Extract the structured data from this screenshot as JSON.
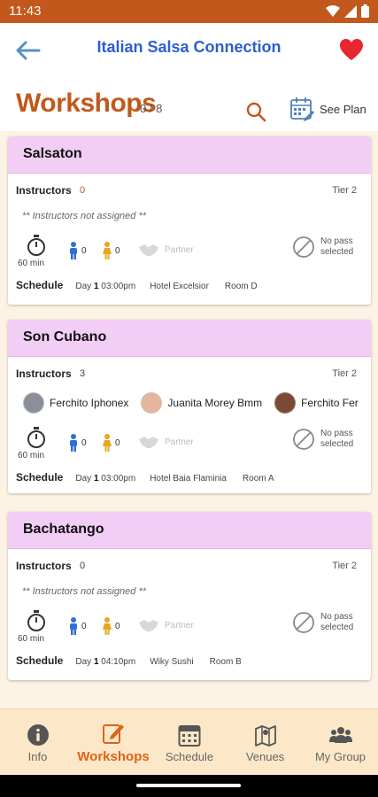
{
  "status_bar": {
    "time": "11:43"
  },
  "header": {
    "title": "Italian Salsa Connection"
  },
  "page": {
    "title": "Workshops",
    "count": "0 / 8",
    "see_plan_label": "See Plan"
  },
  "workshops": [
    {
      "name": "Salsaton",
      "instructors_label": "Instructors",
      "instructors_count": "0",
      "tier": "Tier 2",
      "not_assigned": "** Instructors not assigned **",
      "duration": "60 min",
      "male_count": "0",
      "female_count": "0",
      "partner_label": "Partner",
      "pass_label": "No pass selected",
      "schedule_label": "Schedule",
      "day_label": "Day",
      "day_num": "1",
      "time": "03:00pm",
      "venue": "Hotel Excelsior",
      "room": "Room D"
    },
    {
      "name": "Son Cubano",
      "instructors_label": "Instructors",
      "instructors_count": "3",
      "tier": "Tier 2",
      "instructors": [
        {
          "name": "Ferchito Iphonex",
          "avatar_color": "#8a8f9a"
        },
        {
          "name": "Juanita Morey Bmm",
          "avatar_color": "#e3b6a0"
        },
        {
          "name": "Ferchito Fer",
          "avatar_color": "#7a4a36"
        }
      ],
      "duration": "60 min",
      "male_count": "0",
      "female_count": "0",
      "partner_label": "Partner",
      "pass_label": "No pass selected",
      "schedule_label": "Schedule",
      "day_label": "Day",
      "day_num": "1",
      "time": "03:00pm",
      "venue": "Hotel Baia Flaminia",
      "room": "Room A"
    },
    {
      "name": "Bachatango",
      "instructors_label": "Instructors",
      "instructors_count": "0",
      "tier": "Tier 2",
      "not_assigned": "** Instructors not assigned **",
      "duration": "60 min",
      "male_count": "0",
      "female_count": "0",
      "partner_label": "Partner",
      "pass_label": "No pass selected",
      "schedule_label": "Schedule",
      "day_label": "Day",
      "day_num": "1",
      "time": "04:10pm",
      "venue": "Wiky Sushi",
      "room": "Room B"
    }
  ],
  "tabs": [
    {
      "label": "Info",
      "icon": "info-icon"
    },
    {
      "label": "Workshops",
      "icon": "edit-icon",
      "active": true
    },
    {
      "label": "Schedule",
      "icon": "calendar-icon"
    },
    {
      "label": "Venues",
      "icon": "map-icon"
    },
    {
      "label": "My Group",
      "icon": "group-icon"
    }
  ],
  "colors": {
    "accent": "#c2581b",
    "title_blue": "#2b5fd0",
    "card_header": "#f2cdf5",
    "tab_active": "#e0621a",
    "male": "#2f6fd6",
    "female": "#e7a71f"
  }
}
